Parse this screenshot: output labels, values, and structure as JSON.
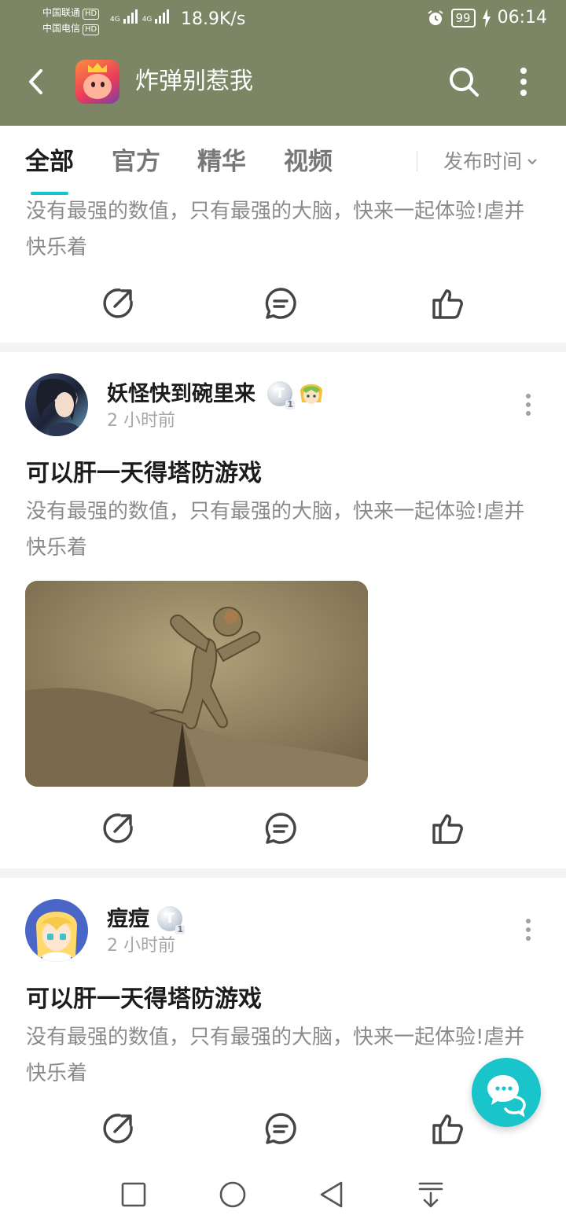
{
  "status_bar": {
    "carrier_1": "中国联通",
    "carrier_2": "中国电信",
    "hd_label": "HD",
    "network_1": "4G",
    "network_2": "4G",
    "speed": "18.9K/s",
    "battery": "99",
    "time": "06:14",
    "icons": [
      "alarm-icon",
      "battery-icon",
      "charging-icon"
    ]
  },
  "app_bar": {
    "title": "炸弹别惹我",
    "icons": [
      "back-icon",
      "search-icon",
      "more-vertical-icon"
    ]
  },
  "tabs": {
    "items": [
      "全部",
      "官方",
      "精华",
      "视频"
    ],
    "active": "全部",
    "sort_label": "发布时间"
  },
  "posts": [
    {
      "text": "没有最强的数值，只有最强的大脑，快来一起体验!虐并快乐着"
    },
    {
      "username": "妖怪快到碗里来",
      "badge": "T",
      "badge_level": "1",
      "time": "2 小时前",
      "title": "可以肝一天得塔防游戏",
      "text": "没有最强的数值，只有最强的大脑，快来一起体验!虐并快乐着"
    },
    {
      "username": "痘痘",
      "badge": "T",
      "badge_level": "1",
      "time": "2 小时前",
      "title": "可以肝一天得塔防游戏",
      "text": "没有最强的数值，只有最强的大脑，快来一起体验!虐并快乐着"
    }
  ],
  "actions": [
    "share-icon",
    "comment-icon",
    "like-icon"
  ],
  "navigation": [
    "recent-apps-icon",
    "home-icon",
    "back-triangle-icon",
    "notification-down-icon"
  ],
  "colors": {
    "app_bar": "#7c8564",
    "accent": "#15c5ce",
    "fab": "#1ac4cb"
  }
}
